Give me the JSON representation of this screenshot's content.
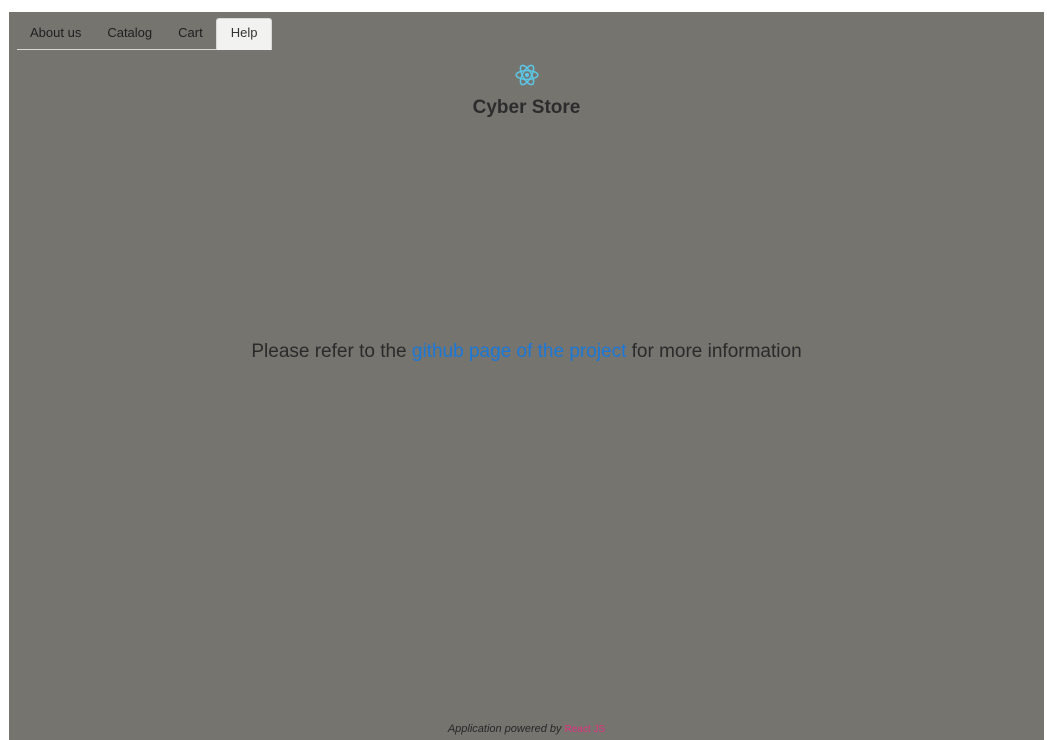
{
  "nav": {
    "items": [
      {
        "label": "About us",
        "active": false
      },
      {
        "label": "Catalog",
        "active": false
      },
      {
        "label": "Cart",
        "active": false
      },
      {
        "label": "Help",
        "active": true
      }
    ]
  },
  "header": {
    "logo_icon": "react-atom-icon",
    "title": "Cyber Store"
  },
  "main": {
    "prefix": "Please refer to the ",
    "link_text": "github page of the project",
    "suffix": " for more information"
  },
  "footer": {
    "prefix": "Application powered by ",
    "link_text": "React JS"
  },
  "colors": {
    "background": "#75746f",
    "link": "#1a78d8",
    "logo": "#5bc7e6",
    "react_link": "#e0307d"
  }
}
